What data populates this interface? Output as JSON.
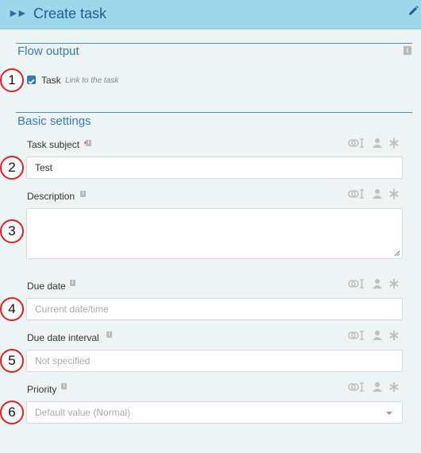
{
  "header": {
    "title": "Create task",
    "expand_icon": "double-chevron-right-icon",
    "edit_icon": "pencil-icon"
  },
  "flow_output": {
    "title": "Flow output",
    "task_checkbox": {
      "label": "Task",
      "hint": "Link to the task",
      "checked": true
    }
  },
  "basic_settings": {
    "title": "Basic settings",
    "task_subject": {
      "label": "Task subject",
      "required_marker": "*",
      "value": "Test"
    },
    "description": {
      "label": "Description",
      "value": ""
    },
    "due_date": {
      "label": "Due date",
      "placeholder": "Current date/time"
    },
    "due_date_interval": {
      "label": "Due date interval",
      "placeholder": "Not specified"
    },
    "priority": {
      "label": "Priority",
      "placeholder": "Default value (Normal)"
    }
  },
  "annotations": [
    "1",
    "2",
    "3",
    "4",
    "5",
    "6"
  ],
  "colors": {
    "header_bg": "#9fd7ea",
    "accent": "#3b7cb5",
    "badge_border": "#e02020",
    "page_bg": "#eef3f3"
  }
}
